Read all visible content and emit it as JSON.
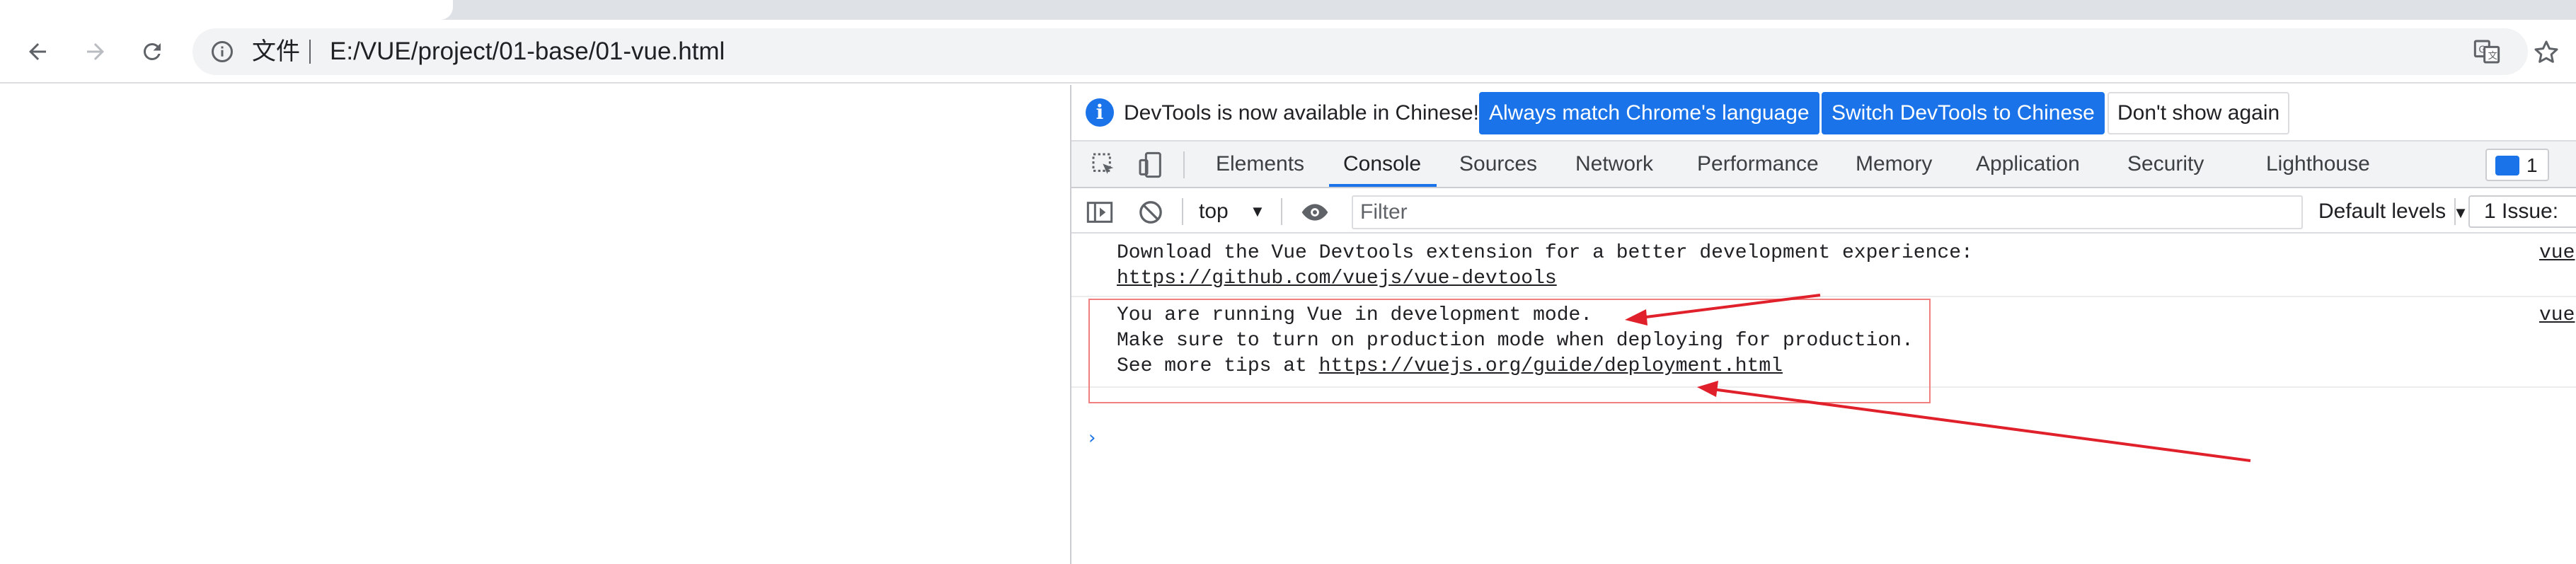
{
  "browser": {
    "security_chip": "文件",
    "url": "E:/VUE/project/01-base/01-vue.html"
  },
  "devtools": {
    "infobar": {
      "message": "DevTools is now available in Chinese!",
      "btn_match": "Always match Chrome's language",
      "btn_switch": "Switch DevTools to Chinese",
      "btn_dismiss": "Don't show again"
    },
    "tabs": [
      "Elements",
      "Console",
      "Sources",
      "Network",
      "Performance",
      "Memory",
      "Application",
      "Security",
      "Lighthouse"
    ],
    "active_tab": "Console",
    "messages_badge": "1",
    "console_toolbar": {
      "context": "top",
      "filter_placeholder": "Filter",
      "levels": "Default levels",
      "issues": "1 Issue:"
    },
    "console": {
      "msg1_line1": "Download the Vue Devtools extension for a better development experience:",
      "msg1_link": "https://github.com/vuejs/vue-devtools",
      "msg1_source": "vue",
      "msg2_line1": "You are running Vue in development mode.",
      "msg2_line2": "Make sure to turn on production mode when deploying for production.",
      "msg2_line3_prefix": "See more tips at ",
      "msg2_link": "https://vuejs.org/guide/deployment.html",
      "msg2_source": "vue",
      "prompt": "›"
    }
  },
  "colors": {
    "accent": "#1a73e8",
    "annotation": "#e0202a",
    "highlight_border": "#f08080"
  }
}
